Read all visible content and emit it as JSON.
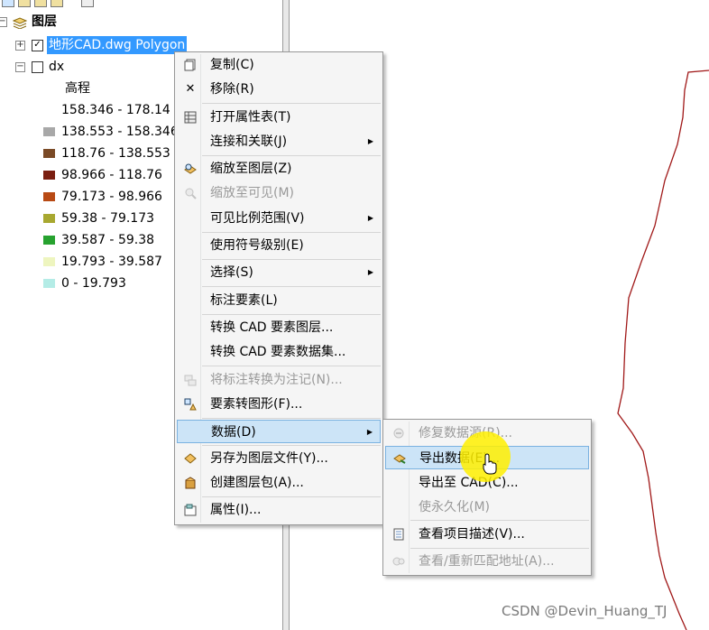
{
  "toc": {
    "root_label": "图层",
    "layers": [
      {
        "name": "地形CAD.dwg Polygon",
        "checked": true,
        "expander": "+"
      },
      {
        "name": "dx",
        "checked": false,
        "expander": "−"
      }
    ],
    "legend_heading": "高程",
    "legend": [
      {
        "label": "158.346 - 178.14",
        "color": "#ffffff"
      },
      {
        "label": "138.553 - 158.346",
        "color": "#a8a8a8"
      },
      {
        "label": "118.76 - 138.553",
        "color": "#7a4a26"
      },
      {
        "label": "98.966 - 118.76",
        "color": "#7a1e10"
      },
      {
        "label": "79.173 - 98.966",
        "color": "#b84a14"
      },
      {
        "label": "59.38 - 79.173",
        "color": "#a8a830"
      },
      {
        "label": "39.587 - 59.38",
        "color": "#27a22f"
      },
      {
        "label": "19.793 - 39.587",
        "color": "#eef5bf"
      },
      {
        "label": "0 - 19.793",
        "color": "#b4ece6"
      }
    ]
  },
  "context_menu": {
    "items": [
      {
        "label": "复制(C)",
        "icon": "copy-icon"
      },
      {
        "label": "移除(R)",
        "icon": "remove-icon"
      },
      {
        "label": "打开属性表(T)",
        "icon": "table-icon"
      },
      {
        "label": "连接和关联(J)",
        "icon": "",
        "submenu": true
      },
      {
        "label": "缩放至图层(Z)",
        "icon": "zoom-layer-icon"
      },
      {
        "label": "缩放至可见(M)",
        "icon": "zoom-visible-icon",
        "disabled": true
      },
      {
        "label": "可见比例范围(V)",
        "icon": "",
        "submenu": true
      },
      {
        "label": "使用符号级别(E)",
        "icon": ""
      },
      {
        "label": "选择(S)",
        "icon": "",
        "submenu": true
      },
      {
        "label": "标注要素(L)",
        "icon": ""
      },
      {
        "label": "转换 CAD 要素图层...",
        "icon": ""
      },
      {
        "label": "转换 CAD 要素数据集...",
        "icon": ""
      },
      {
        "label": "将标注转换为注记(N)...",
        "icon": "convert-labels-icon",
        "disabled": true
      },
      {
        "label": "要素转图形(F)...",
        "icon": "features-to-graphics-icon"
      },
      {
        "label": "数据(D)",
        "icon": "",
        "submenu": true,
        "highlighted": true
      },
      {
        "label": "另存为图层文件(Y)...",
        "icon": "save-layer-icon"
      },
      {
        "label": "创建图层包(A)...",
        "icon": "layer-package-icon"
      },
      {
        "label": "属性(I)...",
        "icon": "properties-icon"
      }
    ]
  },
  "submenu": {
    "items": [
      {
        "label": "修复数据源(R)...",
        "icon": "repair-source-icon",
        "disabled": true
      },
      {
        "label": "导出数据(E)...",
        "icon": "export-data-icon",
        "highlighted": true
      },
      {
        "label": "导出至 CAD(C)...",
        "icon": ""
      },
      {
        "label": "使永久化(M)",
        "icon": "",
        "disabled": true
      },
      {
        "label": "查看项目描述(V)...",
        "icon": "item-description-icon"
      },
      {
        "label": "查看/重新匹配地址(A)...",
        "icon": "rematch-address-icon",
        "disabled": true
      }
    ]
  },
  "watermark": "CSDN @Devin_Huang_TJ",
  "colors": {
    "selection": "#3399ff",
    "menu_highlight": "#cce4f7",
    "map_line": "#a01818"
  }
}
